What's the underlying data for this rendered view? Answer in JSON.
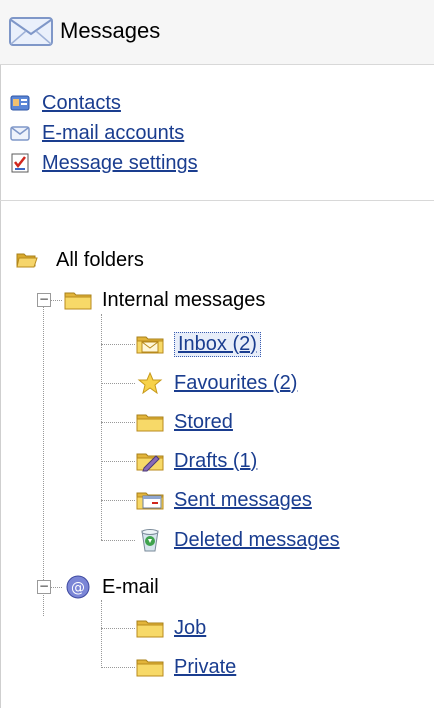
{
  "header": {
    "title": "Messages",
    "icon": "envelope-icon"
  },
  "links": [
    {
      "label": "Contacts",
      "icon": "contacts-card-icon"
    },
    {
      "label": "E-mail accounts",
      "icon": "envelope-icon"
    },
    {
      "label": "Message settings",
      "icon": "checklist-icon"
    }
  ],
  "tree": {
    "root": {
      "label": "All folders",
      "icon": "open-folder-icon"
    },
    "internal": {
      "label": "Internal messages",
      "icon": "folder-icon",
      "children": [
        {
          "label": "Inbox (2)",
          "icon": "inbox-envelope-folder-icon",
          "selected": true
        },
        {
          "label": "Favourites (2)",
          "icon": "star-icon"
        },
        {
          "label": "Stored",
          "icon": "folder-icon"
        },
        {
          "label": "Drafts (1)",
          "icon": "drafts-pencil-icon"
        },
        {
          "label": "Sent messages",
          "icon": "sent-window-icon"
        },
        {
          "label": "Deleted messages",
          "icon": "recycle-bin-icon"
        }
      ]
    },
    "email": {
      "label": "E-mail",
      "icon": "at-sign-icon",
      "children": [
        {
          "label": "Job",
          "icon": "folder-icon"
        },
        {
          "label": "Private",
          "icon": "folder-icon"
        }
      ]
    }
  },
  "colors": {
    "link": "#1a3d8f",
    "folder": "#f2c94c",
    "header_bg": "#f6f6f6"
  }
}
